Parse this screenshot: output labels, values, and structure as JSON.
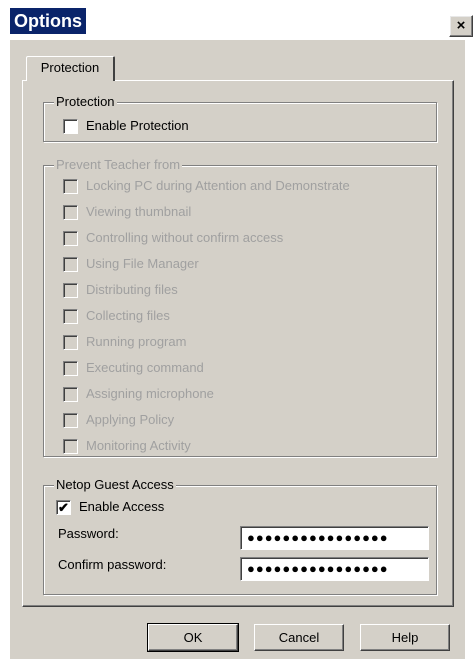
{
  "window": {
    "title": "Options",
    "close_glyph": "×"
  },
  "tabs": [
    {
      "label": "Protection"
    }
  ],
  "protection_group": {
    "legend": "Protection",
    "enable_protection": {
      "label": "Enable Protection",
      "checked": false
    }
  },
  "prevent_group": {
    "legend": "Prevent Teacher from",
    "items": [
      {
        "label": "Locking PC during Attention and Demonstrate",
        "checked": false
      },
      {
        "label": "Viewing thumbnail",
        "checked": false
      },
      {
        "label": "Controlling without confirm access",
        "checked": false
      },
      {
        "label": "Using File Manager",
        "checked": false
      },
      {
        "label": "Distributing files",
        "checked": false
      },
      {
        "label": "Collecting files",
        "checked": false
      },
      {
        "label": "Running program",
        "checked": false
      },
      {
        "label": "Executing command",
        "checked": false
      },
      {
        "label": "Assigning microphone",
        "checked": false
      },
      {
        "label": "Applying Policy",
        "checked": false
      },
      {
        "label": "Monitoring Activity",
        "checked": false
      }
    ]
  },
  "guest_group": {
    "legend": "Netop Guest Access",
    "enable_access": {
      "label": "Enable Access",
      "checked": true,
      "mark": "✔"
    },
    "password_label": "Password:",
    "password_value": "●●●●●●●●●●●●●●●●",
    "confirm_label": "Confirm password:",
    "confirm_value": "●●●●●●●●●●●●●●●●"
  },
  "buttons": {
    "ok": "OK",
    "cancel": "Cancel",
    "help": "Help"
  }
}
